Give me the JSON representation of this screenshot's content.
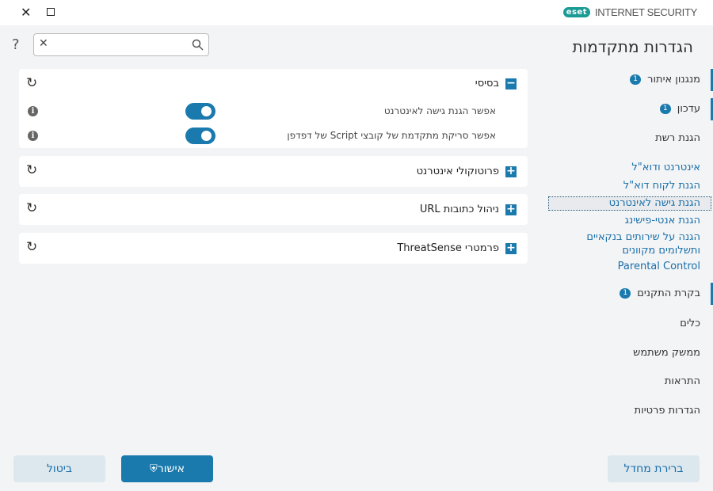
{
  "window": {
    "close_icon": "close-icon",
    "maximize_icon": "maximize-icon"
  },
  "brand": {
    "logo": "eset",
    "product": "INTERNET SECURITY"
  },
  "header": {
    "title": "הגדרות מתקדמות",
    "help": "?"
  },
  "search": {
    "value": "",
    "placeholder": ""
  },
  "sections": [
    {
      "title": "בסיסי",
      "expanded": true,
      "rows": [
        {
          "label": "אפשר הגנת גישה לאינטרנט",
          "enabled": true
        },
        {
          "label": "אפשר סריקת מתקדמת של קובצי Script של דפדפן",
          "enabled": true
        }
      ]
    },
    {
      "title": "פרוטוקולי אינטרנט",
      "expanded": false
    },
    {
      "title": "ניהול כתובות URL",
      "expanded": false
    },
    {
      "title": "פרמטרי ThreatSense",
      "expanded": false
    }
  ],
  "nav": [
    {
      "label": "מנגנון איתור",
      "badge": "1"
    },
    {
      "label": "עדכון",
      "badge": "1"
    },
    {
      "label": "הגנת רשת"
    },
    {
      "label": "אינטרנט ודוא\"ל"
    },
    {
      "label": "הגנת לקוח דוא\"ל"
    },
    {
      "label": "הגנת גישה לאינטרנט",
      "selected": true
    },
    {
      "label": "הגנת אנטי-פישינג"
    },
    {
      "label": "הגנה על שירותים בנקאיים ותשלומים מקוונים"
    },
    {
      "label": "Parental Control"
    },
    {
      "label": "בקרת התקנים",
      "badge": "1"
    },
    {
      "label": "כלים"
    },
    {
      "label": "ממשק משתמש"
    },
    {
      "label": "התראות"
    },
    {
      "label": "הגדרות פרטיות"
    }
  ],
  "buttons": {
    "default": "ברירת מחדל",
    "ok": "אישור",
    "cancel": "ביטול"
  },
  "colors": {
    "accent": "#1a7aad",
    "brand": "#1a9b96"
  }
}
